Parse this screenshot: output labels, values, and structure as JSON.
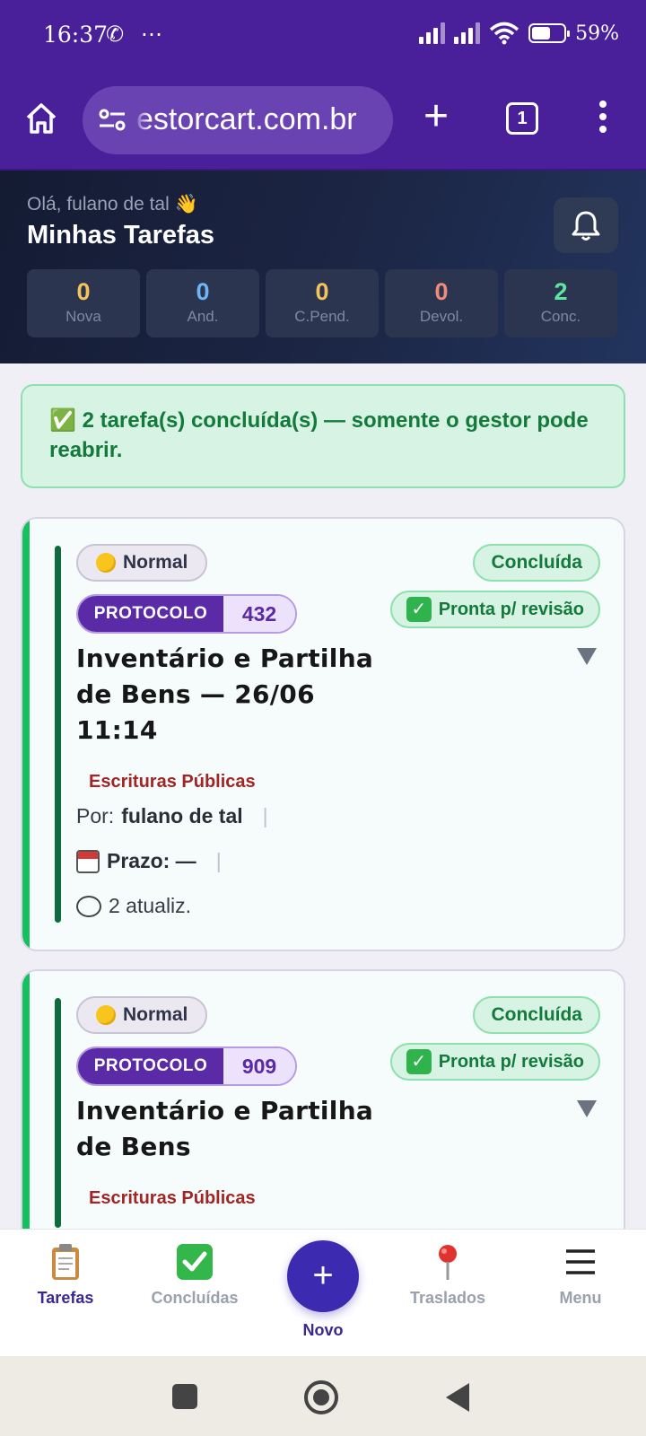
{
  "status_bar": {
    "time": "16:37",
    "left_icons": "✆ ⋯",
    "battery": "59%",
    "battery_level": 0.59
  },
  "browser": {
    "url": "estorcart.com.br",
    "tab_count": "1"
  },
  "header": {
    "greeting": "Olá, fulano de tal 👋",
    "title": "Minhas Tarefas",
    "stats": [
      {
        "value": "0",
        "label": "Nova",
        "color": "#f6c35a"
      },
      {
        "value": "0",
        "label": "And.",
        "color": "#6fb5f5"
      },
      {
        "value": "0",
        "label": "C.Pend.",
        "color": "#f6c35a"
      },
      {
        "value": "0",
        "label": "Devol.",
        "color": "#f08a7a"
      },
      {
        "value": "2",
        "label": "Conc.",
        "color": "#5ee6a0"
      }
    ]
  },
  "alert": {
    "icon": "✅",
    "text": "2 tarefa(s) concluída(s) — somente o gestor pode reabrir."
  },
  "cards": [
    {
      "priority": "Normal",
      "status": "Concluída",
      "protocol_label": "PROTOCOLO",
      "protocol_number": "432",
      "review": "Pronta p/ revisão",
      "title": "Inventário e Partilha de Bens — 26/06 11:14",
      "category": "Escrituras Públicas",
      "author_prefix": "Por:",
      "author": "fulano de tal",
      "deadline": "Prazo: —",
      "updates": "2 atualiz."
    },
    {
      "priority": "Normal",
      "status": "Concluída",
      "protocol_label": "PROTOCOLO",
      "protocol_number": "909",
      "review": "Pronta p/ revisão",
      "title": "Inventário e Partilha de Bens",
      "category": "Escrituras Públicas"
    }
  ],
  "bottom_nav": {
    "items": [
      {
        "label": "Tarefas",
        "icon": "clipboard-icon"
      },
      {
        "label": "Concluídas",
        "icon": "check-mark-button-icon"
      },
      {
        "label": "Novo",
        "icon": "plus-icon"
      },
      {
        "label": "Traslados",
        "icon": "round-pushpin-icon"
      },
      {
        "label": "Menu",
        "icon": "hamburger-menu-icon"
      }
    ]
  }
}
